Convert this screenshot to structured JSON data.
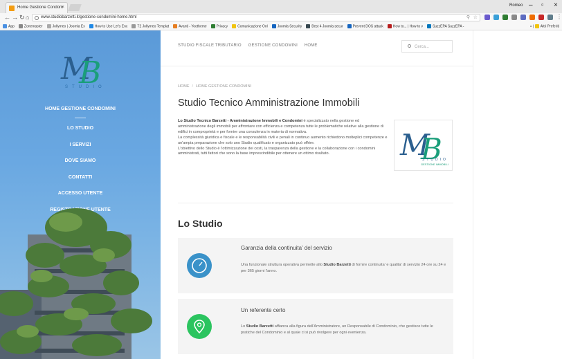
{
  "browser": {
    "tab_title": "Home Gestione Condom",
    "tab_close": "×",
    "user_name": "Romeo",
    "window_minimize": "–",
    "window_maximize": "▫",
    "window_close": "×",
    "url": "www.studiobarzetti.it/gestione-condomini-home.html",
    "bookmarks": [
      {
        "label": "App",
        "color": "#4a90e2"
      },
      {
        "label": "Zonemaster",
        "color": "#888888"
      },
      {
        "label": "Jollymeo | Joomla Ex",
        "color": "#aaaaaa"
      },
      {
        "label": "How to Use Let's Enc",
        "color": "#1e88e5"
      },
      {
        "label": "T2 Jollymeo Templat",
        "color": "#999999"
      },
      {
        "label": "Avanti - Yootheme",
        "color": "#e67e22"
      },
      {
        "label": "Privacy",
        "color": "#2e7d32"
      },
      {
        "label": "Comunicazione Onl",
        "color": "#f1c40f"
      },
      {
        "label": "Joomla Security",
        "color": "#1565c0"
      },
      {
        "label": "Best 4 Joomla secur",
        "color": "#37474f"
      },
      {
        "label": "Prevent DOS attack",
        "color": "#1565c0"
      },
      {
        "label": "How to... | How to v",
        "color": "#b71c1c"
      },
      {
        "label": "SuzzEPA SuzzEPA -",
        "color": "#0277bd"
      }
    ],
    "bookmarks_more": "»",
    "bookmarks_other": "Altri Preferiti"
  },
  "sidebar": {
    "logo_text": "MB",
    "logo_sub": "STUDIO",
    "items": [
      {
        "label": "HOME GESTIONE CONDOMINI"
      },
      {
        "label": "LO STUDIO"
      },
      {
        "label": "I SERVIZI"
      },
      {
        "label": "DOVE SIAMO"
      },
      {
        "label": "CONTATTI"
      },
      {
        "label": "ACCESSO UTENTE"
      },
      {
        "label": "REGISTRAZIONE UTENTE"
      }
    ]
  },
  "topnav": {
    "items": [
      "STUDIO FISCALE TRIBUTARIO",
      "GESTIONE CONDOMINI",
      "HOME"
    ]
  },
  "search": {
    "placeholder": "Cerca..."
  },
  "breadcrumb": {
    "home": "HOME",
    "current": "HOME GESTIONE CONDOMINI"
  },
  "page_title": "Studio Tecnico Amministrazione Immobili",
  "intro": {
    "lead_bold": "Lo Studio Tecnico Barzetti - Amministrazione Immobili e Condomini",
    "p1_rest": " è specializzato nella gestione ed amministrazione degli immobili per affrontare con efficienza e competenza tutte le problematiche relative alla gestione di edifici in comproprietà e per fornire una consulenza in materia di normativa.",
    "p2": "La complessità giuridica e fiscale e le responsabilità civili e penali in continuo aumento richiedono molteplici competenze e un'ampia preparazione che solo uno Studio qualificato e organizzato può offrire.",
    "p3": "L'obiettivo dello Studio è l'ottimizzazione dei costi, la trasparenza della gestione e la collaborazione con i condomini amministrati, tutti fattori che sono la base imprescindibile per ottenere un ottimo risultato."
  },
  "intro_logo": {
    "text": "MB",
    "sub1": "STUDIO",
    "sub2": "GESTIONE IMMOBILI"
  },
  "section_title": "Lo Studio",
  "features": [
    {
      "title": "Garanzia della continuita' del servizio",
      "desc_pre": "Una funzionale struttura operativa permette allo ",
      "desc_bold": "Studio Barzetti",
      "desc_post": " di fornire continuita' e qualita' di servizio 24 ore su 24 e per 365 giorni l'anno.",
      "icon": "clock-icon",
      "color": "#3a92c9"
    },
    {
      "title": "Un referente certo",
      "desc_pre": "Lo ",
      "desc_bold": "Studio Barzetti",
      "desc_post": " affianca alla figura dell'Amministratore, un Responsabile di Condominio, che gestisce tutte le pratiche del Condominio e al quale ci si può rivolgere per ogni evenienza.",
      "icon": "map-pin-icon",
      "color": "#2bc45f"
    }
  ]
}
